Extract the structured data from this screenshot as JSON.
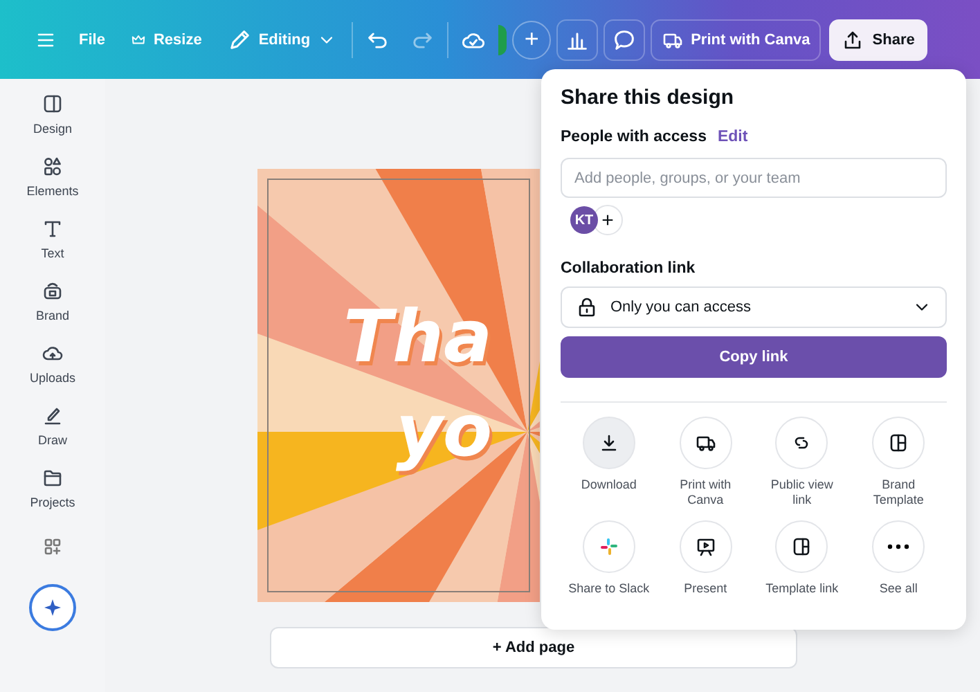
{
  "toolbar": {
    "menu": [
      {
        "label": "File",
        "kind": "plain"
      },
      {
        "label": "Resize",
        "kind": "crown"
      },
      {
        "label": "Editing",
        "kind": "pencil"
      }
    ],
    "add_button": "+",
    "print_button": "Print with Canva",
    "share_button": "Share"
  },
  "sidebar": {
    "items": [
      {
        "label": "Design",
        "kind": "design"
      },
      {
        "label": "Elements",
        "kind": "elements"
      },
      {
        "label": "Text",
        "kind": "text"
      },
      {
        "label": "Brand",
        "kind": "brand"
      },
      {
        "label": "Uploads",
        "kind": "uploads"
      },
      {
        "label": "Draw",
        "kind": "draw"
      },
      {
        "label": "Projects",
        "kind": "projects"
      }
    ]
  },
  "design": {
    "lines": [
      "Tha",
      "yo"
    ]
  },
  "add_page": "+ Add page",
  "share_panel": {
    "title": "Share this design",
    "people_label": "People with access",
    "edit_link": "Edit",
    "search": {
      "placeholder": "Add people, groups, or your team"
    },
    "avatar": "KT",
    "add_person": "+",
    "collab_label": "Collaboration link",
    "access": "Only you can access",
    "copy_button": "Copy link",
    "options": [
      {
        "label": "Download",
        "kind": "download",
        "hovered": true
      },
      {
        "label": "Print with Canva",
        "kind": "print",
        "hovered": false
      },
      {
        "label": "Public view link",
        "kind": "link",
        "hovered": false
      },
      {
        "label": "Brand Template",
        "kind": "brand",
        "hovered": false
      },
      {
        "label": "Share to Slack",
        "kind": "slack",
        "hovered": false
      },
      {
        "label": "Present",
        "kind": "present",
        "hovered": false
      },
      {
        "label": "Template link",
        "kind": "template",
        "hovered": false
      },
      {
        "label": "See all",
        "kind": "more",
        "hovered": false
      }
    ]
  }
}
